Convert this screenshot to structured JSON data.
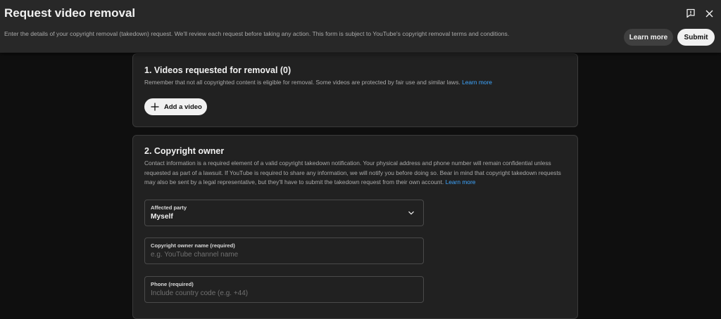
{
  "header": {
    "title": "Request video removal",
    "subtitle": "Enter the details of your copyright removal (takedown) request. We'll review each request before taking any action. This form is subject to YouTube's copyright removal terms and conditions.",
    "learn_more": "Learn more",
    "submit": "Submit",
    "icons": [
      "feedback-icon",
      "close-icon"
    ]
  },
  "videos_section": {
    "title": "1. Videos requested for removal (0)",
    "description": "Remember that not all copyrighted content is eligible for removal. Some videos are protected by fair use and similar laws.",
    "learn_more": "Learn more",
    "add_video": "Add a video"
  },
  "owner_section": {
    "title": "2. Copyright owner",
    "description": "Contact information is a required element of a valid copyright takedown notification. Your physical address and phone number will remain confidential unless requested as part of a lawsuit. If YouTube is required to share any information, we will notify you before doing so. Bear in mind that copyright takedown requests may also be sent by a legal representative, but they'll have to submit the takedown request from their own account.",
    "learn_more": "Learn more",
    "affected_party": {
      "label": "Affected party",
      "value": "Myself"
    },
    "owner_name": {
      "label": "Copyright owner name (required)",
      "placeholder": "e.g. YouTube channel name",
      "value": ""
    },
    "phone": {
      "label": "Phone (required)",
      "placeholder": "Include country code (e.g. +44)",
      "value": ""
    }
  },
  "colors": {
    "background": "#0f0f0f",
    "header": "#282828",
    "card": "#212121",
    "link": "#3ea6ff",
    "primary_button": "#f1f1f1"
  }
}
